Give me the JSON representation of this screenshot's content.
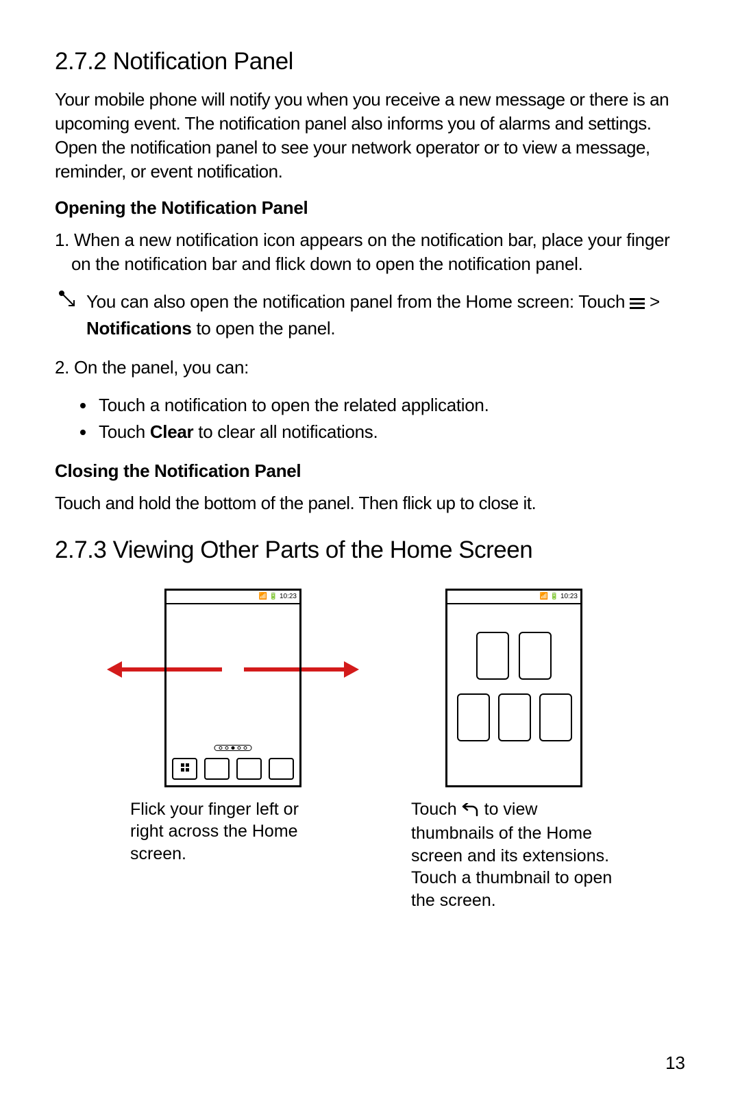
{
  "section_2_7_2": {
    "heading": "2.7.2  Notification Panel",
    "intro": "Your mobile phone will notify you when you receive a new message or there is an upcoming event. The notification panel also informs you of alarms and settings. Open the notification panel to see your network operator or to view a message, reminder, or event notification.",
    "opening": {
      "heading": "Opening the Notification Panel",
      "step1": "1. When a new notification icon appears on the notification bar, place your finger on the notification bar and flick down to open the notification panel.",
      "tip_before": "You can also open the notification panel from the Home screen: Touch ",
      "tip_after": " > ",
      "tip_line2_bold": "Notifications",
      "tip_line2_rest": " to open the panel.",
      "step2": "2. On the panel, you can:",
      "bullets": {
        "b1": "Touch a notification to open the related application.",
        "b2_before": "Touch ",
        "b2_bold": "Clear",
        "b2_after": " to clear all notifications."
      }
    },
    "closing": {
      "heading": "Closing the Notification Panel",
      "text": "Touch and hold the bottom of the panel. Then flick up to close it."
    }
  },
  "section_2_7_3": {
    "heading": "2.7.3  Viewing Other Parts of the Home Screen",
    "fig1_caption": "Flick your finger left or right across the Home screen.",
    "fig2_caption_before": "Touch ",
    "fig2_caption_after": " to view thumbnails of the Home screen and its extensions. Touch a thumbnail to open the screen.",
    "status_time": "10:23"
  },
  "page_number": "13"
}
